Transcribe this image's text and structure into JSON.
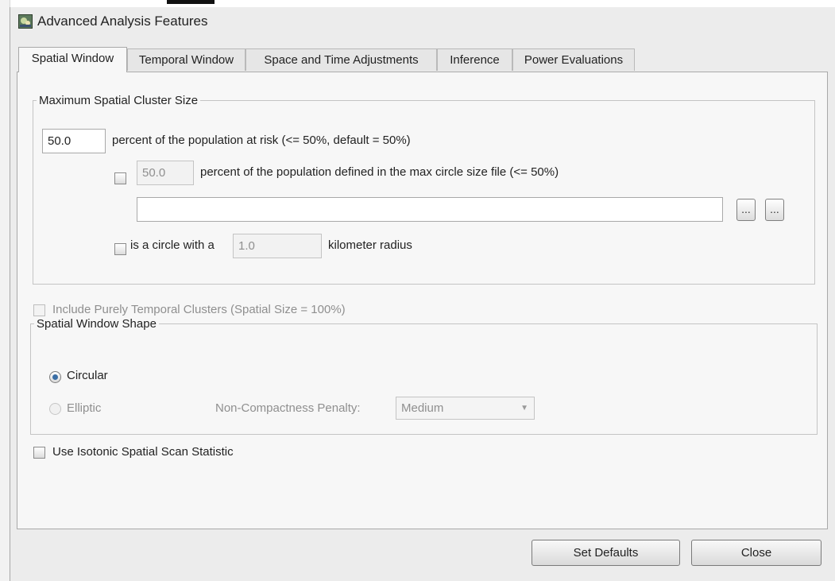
{
  "window": {
    "title": "Advanced Analysis Features",
    "icon": "app-icon"
  },
  "tabs": [
    {
      "label": "Spatial Window",
      "active": true
    },
    {
      "label": "Temporal Window",
      "active": false
    },
    {
      "label": "Space and Time Adjustments",
      "active": false
    },
    {
      "label": "Inference",
      "active": false
    },
    {
      "label": "Power Evaluations",
      "active": false
    }
  ],
  "max_cluster": {
    "legend": "Maximum Spatial Cluster Size",
    "population_value": "50.0",
    "population_label": "percent of the population at risk (<= 50%, default = 50%)",
    "max_circle_checked": false,
    "max_circle_value": "50.0",
    "max_circle_label": "percent of the population defined in the max circle size file (<= 50%)",
    "file_path": "",
    "browse_label": "...",
    "import_label": "...",
    "radius_checked": false,
    "radius_prefix": "is a circle with a",
    "radius_value": "1.0",
    "radius_suffix": "kilometer radius"
  },
  "purely_temporal": {
    "label": "Include Purely Temporal Clusters (Spatial Size = 100%)",
    "checked": false,
    "enabled": false
  },
  "shape": {
    "legend": "Spatial Window Shape",
    "circular_label": "Circular",
    "circular_selected": true,
    "elliptic_label": "Elliptic",
    "elliptic_enabled": false,
    "penalty_label": "Non-Compactness Penalty:",
    "penalty_value": "Medium"
  },
  "isotonic": {
    "label": "Use Isotonic Spatial Scan Statistic",
    "checked": false
  },
  "footer": {
    "set_defaults_label": "Set Defaults",
    "close_label": "Close"
  },
  "colors": {
    "radio_dot": "#3a6ea5",
    "panel": "#f7f7f7",
    "window": "#ececec"
  }
}
